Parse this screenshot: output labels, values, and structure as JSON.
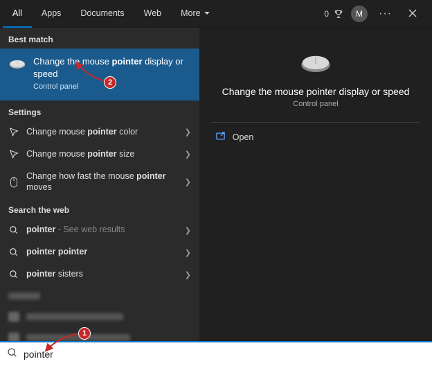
{
  "tabs": {
    "items": [
      "All",
      "Apps",
      "Documents",
      "Web",
      "More"
    ],
    "active_index": 0
  },
  "header": {
    "reward_points": "0",
    "avatar_initial": "M"
  },
  "left": {
    "best_match_header": "Best match",
    "best_match": {
      "title_pre": "Change the mouse ",
      "title_bold": "pointer",
      "title_post": " display or speed",
      "subtitle": "Control panel"
    },
    "settings_header": "Settings",
    "settings": [
      {
        "pre": "Change mouse ",
        "bold": "pointer",
        "post": " color"
      },
      {
        "pre": "Change mouse ",
        "bold": "pointer",
        "post": " size"
      },
      {
        "pre": "Change how fast the mouse ",
        "bold": "pointer",
        "post": " moves"
      }
    ],
    "web_header": "Search the web",
    "web": [
      {
        "bold": "pointer",
        "suffix": " - See web results"
      },
      {
        "bold": "pointer",
        "post_bold": "pointer"
      },
      {
        "bold": "pointer",
        "post": " sisters"
      }
    ]
  },
  "right": {
    "title": "Change the mouse pointer display or speed",
    "subtitle": "Control panel",
    "open_label": "Open"
  },
  "search": {
    "value": "pointer"
  },
  "annotations": {
    "a1": "1",
    "a2": "2"
  }
}
